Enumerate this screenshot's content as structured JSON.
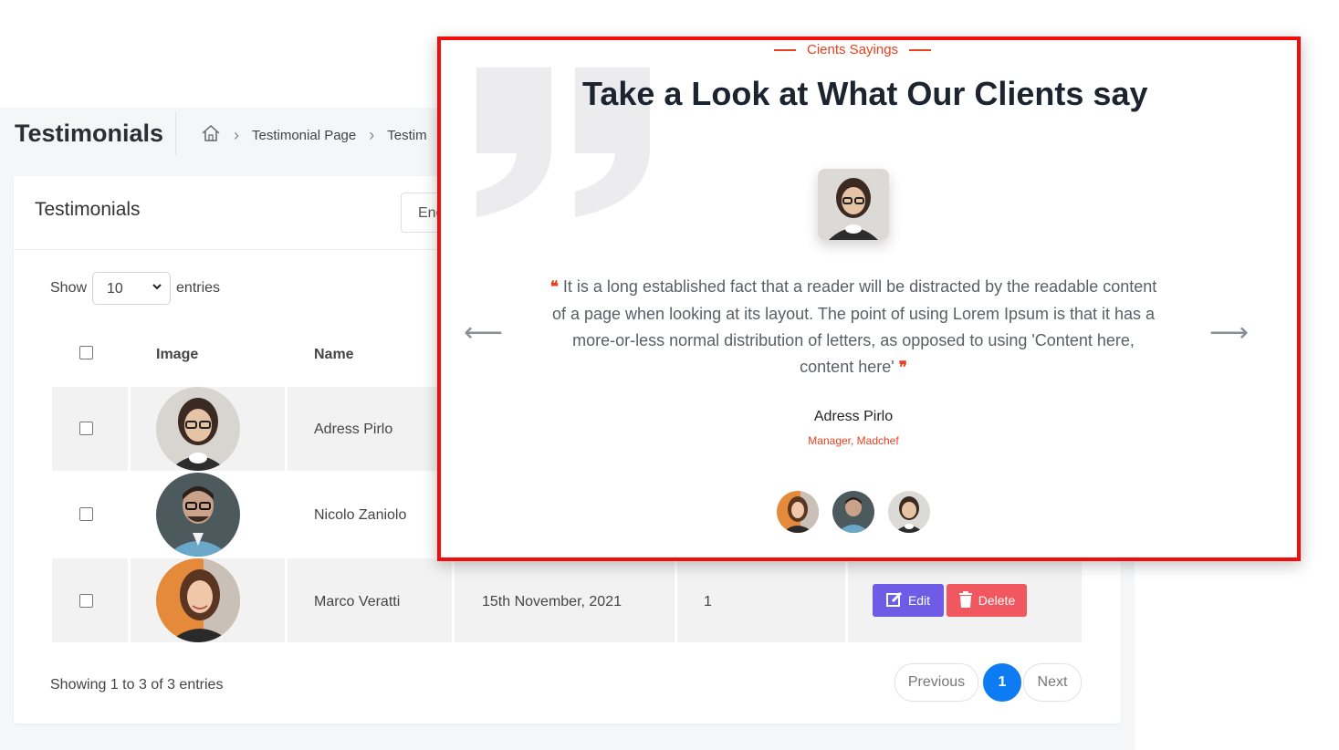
{
  "header": {
    "page_title": "Testimonials",
    "breadcrumb": [
      "Testimonial Page",
      "Testim"
    ]
  },
  "card": {
    "title": "Testimonials",
    "language_value": "Eng"
  },
  "controls": {
    "show_label": "Show",
    "entries_value": "10",
    "entries_label": "entries"
  },
  "table": {
    "headers": {
      "image": "Image",
      "name": "Name"
    },
    "rows": [
      {
        "name": "Adress Pirlo"
      },
      {
        "name": "Nicolo Zaniolo"
      },
      {
        "name": "Marco Veratti",
        "date": "15th November, 2021",
        "order": "1"
      }
    ],
    "edit_label": "Edit",
    "delete_label": "Delete"
  },
  "footer": {
    "showing": "Showing 1 to 3 of 3 entries",
    "prev_label": "Previous",
    "page": "1",
    "next_label": "Next"
  },
  "preview": {
    "subtitle": "Cients Sayings",
    "headline": "Take a Look at What Our Clients say",
    "quote": "It is a long established fact that a reader will be distracted by the readable content of a page when looking at its layout. The point of using Lorem Ipsum is that it has a more-or-less normal distribution of letters, as opposed to using 'Content here, content here'",
    "open_quote": "❝",
    "close_quote": "❞",
    "client_name": "Adress Pirlo",
    "client_role": "Manager, Madchef",
    "prev_arrow": "⟵",
    "next_arrow": "⟶"
  },
  "colors": {
    "accent": "#e9401f",
    "frame": "#f20d0d",
    "edit": "#6f5ce6",
    "delete": "#f0575f",
    "pager_active": "#0d7cf2"
  }
}
